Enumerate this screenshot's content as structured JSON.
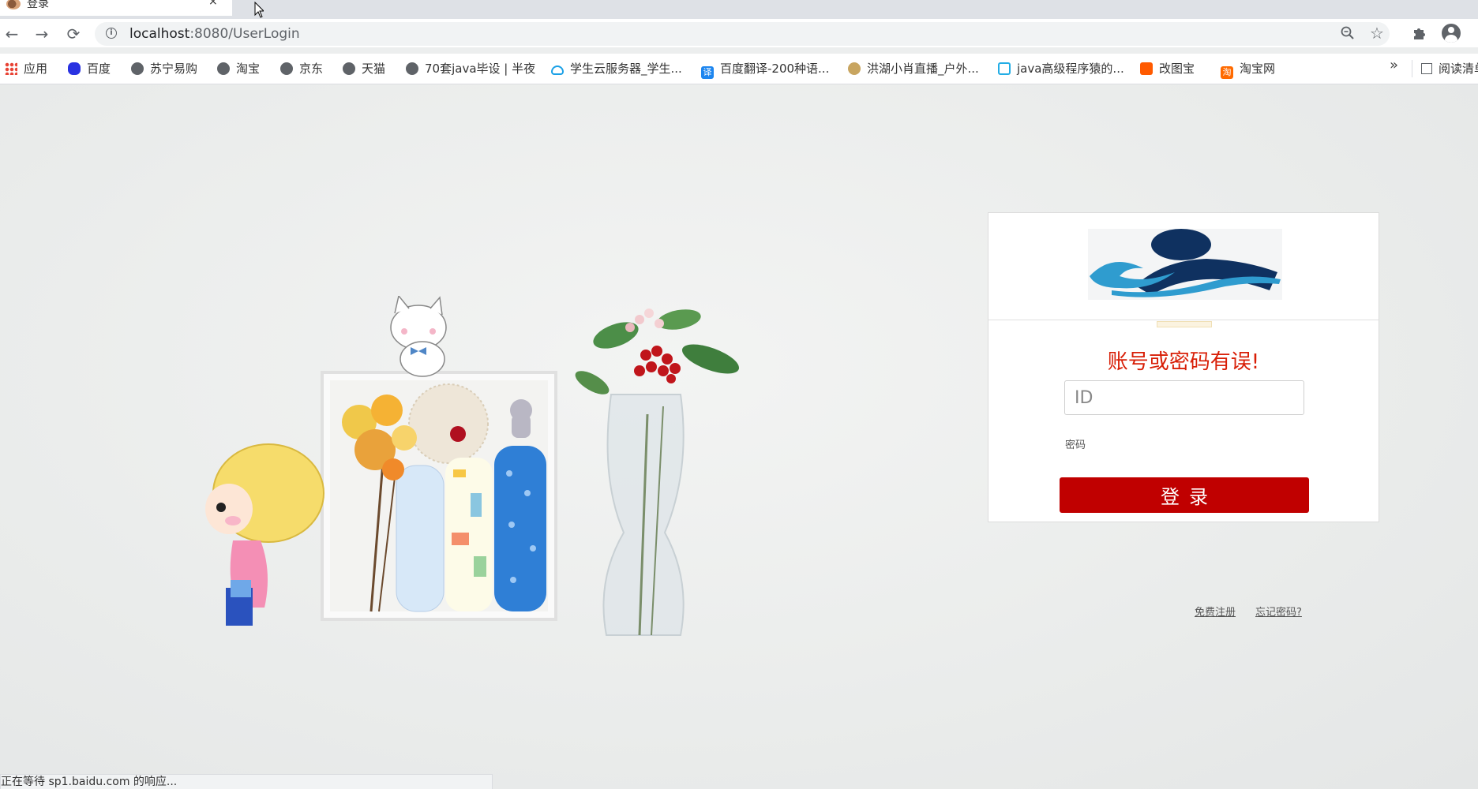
{
  "browser": {
    "tab_title": "登录",
    "tab_close": "×",
    "url_host": "localhost",
    "url_path": ":8080/UserLogin",
    "nav": {
      "back": "←",
      "forward": "→",
      "reload": "⟳"
    },
    "status_text": "正在等待 sp1.baidu.com 的响应...",
    "more_bookmarks": "»",
    "reading_list": "阅读清单"
  },
  "bookmarks": [
    {
      "label": "应用",
      "icon": "apps-icon"
    },
    {
      "label": "百度",
      "icon": "baidu-icon"
    },
    {
      "label": "苏宁易购",
      "icon": "globe-icon"
    },
    {
      "label": "淘宝",
      "icon": "globe-icon"
    },
    {
      "label": "京东",
      "icon": "globe-icon"
    },
    {
      "label": "天猫",
      "icon": "globe-icon"
    },
    {
      "label": "70套java毕设 | 半夜",
      "icon": "globe-icon"
    },
    {
      "label": "学生云服务器_学生...",
      "icon": "cloud-icon"
    },
    {
      "label": "百度翻译-200种语...",
      "icon": "translate-icon"
    },
    {
      "label": "洪湖小肖直播_户外...",
      "icon": "bird-icon"
    },
    {
      "label": "java高级程序猿的...",
      "icon": "bilibili-icon"
    },
    {
      "label": "改图宝",
      "icon": "gaitubao-icon"
    },
    {
      "label": "淘宝网",
      "icon": "taobao-icon"
    }
  ],
  "login": {
    "error_message": "账号或密码有误!",
    "id_placeholder": "ID",
    "password_label": "密码",
    "submit_label": "登录",
    "register_link": "免费注册",
    "forgot_link": "忘记密码?"
  },
  "colors": {
    "accent": "#c00000",
    "error": "#d81e06",
    "logo_dark": "#0f3160",
    "logo_wave": "#2f9ccf"
  }
}
